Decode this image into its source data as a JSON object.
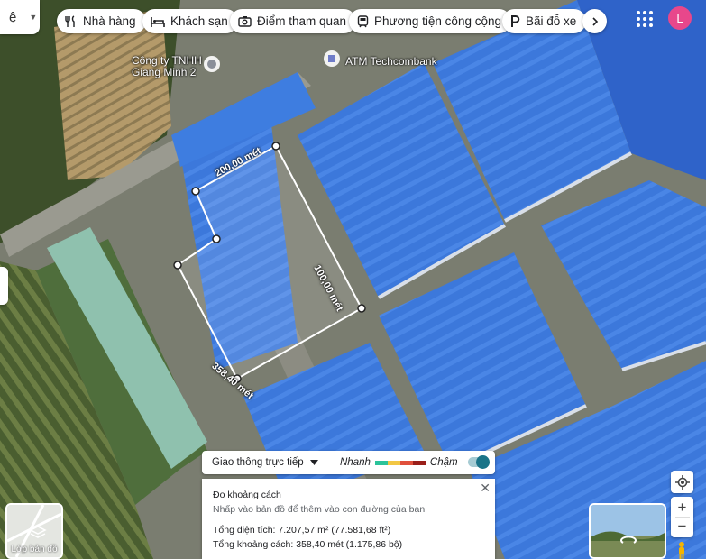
{
  "search": {
    "text": "ệ"
  },
  "chips": [
    {
      "label": "Nhà hàng",
      "icon": "restaurant-icon"
    },
    {
      "label": "Khách sạn",
      "icon": "hotel-icon"
    },
    {
      "label": "Điểm tham quan",
      "icon": "camera-icon"
    },
    {
      "label": "Phương tiện công cộng",
      "icon": "transit-icon"
    },
    {
      "label": "Bãi đỗ xe",
      "icon": "parking-icon"
    }
  ],
  "user": {
    "avatar_letter": "L",
    "avatar_color": "#e8478b"
  },
  "places": [
    {
      "name": "Công ty TNHH Giang Minh 2",
      "line1": "Công ty TNHH",
      "line2": "Giang Minh 2"
    },
    {
      "name": "ATM Techcombank"
    }
  ],
  "measure_labels": {
    "segment_top": "200,00 mét",
    "segment_right": "100,00 mét",
    "segment_bottom": "358,40 mét"
  },
  "traffic": {
    "select_label": "Giao thông trực tiếp",
    "fast": "Nhanh",
    "slow": "Chậm",
    "colors": [
      "#2bc39a",
      "#f2c744",
      "#e0503c",
      "#9a1f1a"
    ],
    "enabled": true
  },
  "measure_panel": {
    "title": "Đo khoảng cách",
    "hint": "Nhấp vào bản đồ để thêm vào con đường của bạn",
    "area": "Tổng diện tích: 7.207,57 m² (77.581,68 ft²)",
    "distance": "Tổng khoảng cách: 358,40 mét (1.175,86 bộ)"
  },
  "layers": {
    "label": "Lớp bản đồ"
  },
  "colors": {
    "roof_blue": "#3f7fe0",
    "road": "#8a8a84",
    "vegetation": "#556b3c"
  }
}
